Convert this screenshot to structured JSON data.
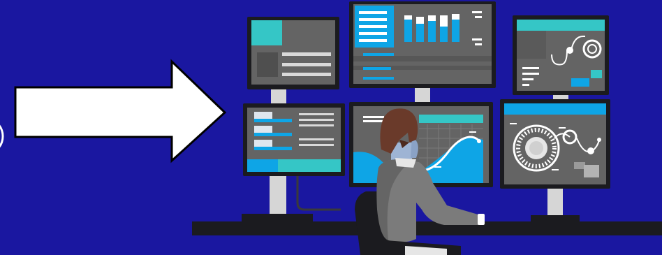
{
  "colors": {
    "background": "#1a17a0",
    "arrow_fill": "#ffffff",
    "arrow_stroke": "#000000",
    "monitor_bezel": "#1b1b1f",
    "screen_bg": "#646464",
    "accent_cyan": "#35c6c6",
    "accent_blue": "#0ea5e6",
    "stand": "#d6d6d6",
    "desk": "#1b1b1f",
    "person_hair": "#6a3a2a",
    "person_skin": "#9eb4d4",
    "person_shirt": "#7b7b7b",
    "chair": "#1b1b1f"
  },
  "icons": {
    "arrow": "right-arrow-icon",
    "circle_edge": "circle-outline-icon",
    "person": "operator-person-icon"
  }
}
